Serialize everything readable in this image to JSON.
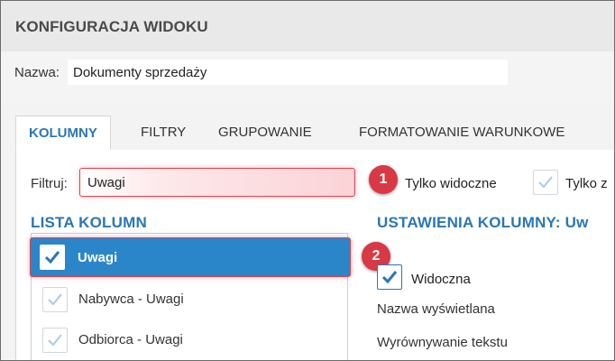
{
  "window": {
    "title": "KONFIGURACJA WIDOKU"
  },
  "name_field": {
    "label": "Nazwa:",
    "value": "Dokumenty sprzedaży"
  },
  "tabs": [
    {
      "label": "KOLUMNY",
      "active": true
    },
    {
      "label": "FILTRY",
      "active": false
    },
    {
      "label": "GRUPOWANIE",
      "active": false
    },
    {
      "label": "FORMATOWANIE WARUNKOWE",
      "active": false
    }
  ],
  "filter": {
    "label": "Filtruj:",
    "value": "Uwagi",
    "badge": "1",
    "only_visible_label": "Tylko widoczne",
    "only_z_label": "Tylko z",
    "only_z_checked": true
  },
  "columns_list": {
    "title": "LISTA KOLUMN",
    "badge": "2",
    "items": [
      {
        "label": "Uwagi",
        "checked": true,
        "selected": true
      },
      {
        "label": "Nabywca - Uwagi",
        "checked": true,
        "selected": false
      },
      {
        "label": "Odbiorca - Uwagi",
        "checked": true,
        "selected": false
      }
    ]
  },
  "column_settings": {
    "title": "USTAWIENIA KOLUMNY: Uw",
    "visible_label": "Widoczna",
    "visible_checked": true,
    "display_name_label": "Nazwa wyświetlana",
    "alignment_label": "Wyrównywanie tekstu"
  },
  "colors": {
    "accent": "#2a77b3",
    "selection": "#2a86c8",
    "highlight": "#e3404b",
    "badge": "#d93845"
  }
}
